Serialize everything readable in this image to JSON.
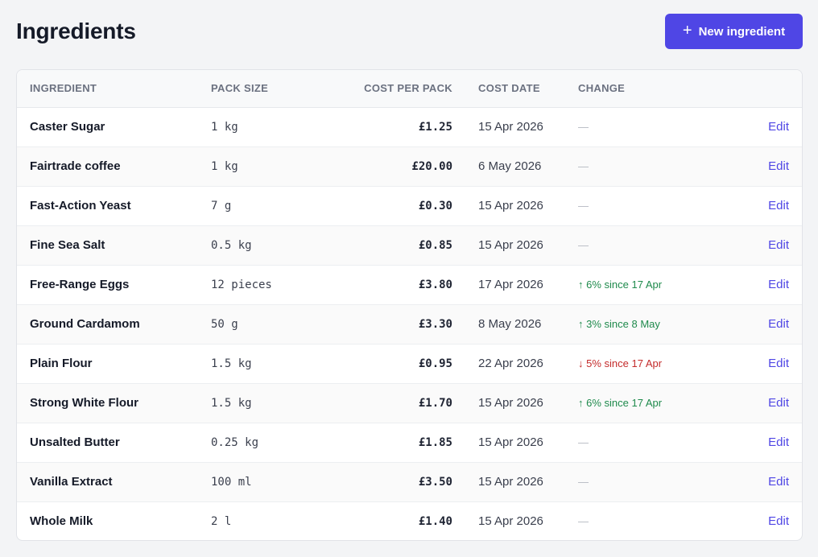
{
  "page": {
    "title": "Ingredients",
    "new_button": {
      "icon": "plus-icon",
      "icon_glyph": "+",
      "label": "New ingredient"
    }
  },
  "colors": {
    "accent": "#4f46e5",
    "increase": "#1f8a4c",
    "decrease": "#c42b2b"
  },
  "table": {
    "columns": [
      "INGREDIENT",
      "PACK SIZE",
      "COST PER PACK",
      "COST DATE",
      "CHANGE",
      ""
    ],
    "edit_label": "Edit",
    "rows": [
      {
        "name": "Caster Sugar",
        "pack": "1 kg",
        "cost": "£1.25",
        "date": "15 Apr 2026",
        "change": "—",
        "dir": "none"
      },
      {
        "name": "Fairtrade coffee",
        "pack": "1 kg",
        "cost": "£20.00",
        "date": "6 May 2026",
        "change": "—",
        "dir": "none"
      },
      {
        "name": "Fast-Action Yeast",
        "pack": "7 g",
        "cost": "£0.30",
        "date": "15 Apr 2026",
        "change": "—",
        "dir": "none"
      },
      {
        "name": "Fine Sea Salt",
        "pack": "0.5 kg",
        "cost": "£0.85",
        "date": "15 Apr 2026",
        "change": "—",
        "dir": "none"
      },
      {
        "name": "Free-Range Eggs",
        "pack": "12 pieces",
        "cost": "£3.80",
        "date": "17 Apr 2026",
        "change": "↑ 6% since 17 Apr",
        "dir": "up"
      },
      {
        "name": "Ground Cardamom",
        "pack": "50 g",
        "cost": "£3.30",
        "date": "8 May 2026",
        "change": "↑ 3% since 8 May",
        "dir": "up"
      },
      {
        "name": "Plain Flour",
        "pack": "1.5 kg",
        "cost": "£0.95",
        "date": "22 Apr 2026",
        "change": "↓ 5% since 17 Apr",
        "dir": "down"
      },
      {
        "name": "Strong White Flour",
        "pack": "1.5 kg",
        "cost": "£1.70",
        "date": "15 Apr 2026",
        "change": "↑ 6% since 17 Apr",
        "dir": "up"
      },
      {
        "name": "Unsalted Butter",
        "pack": "0.25 kg",
        "cost": "£1.85",
        "date": "15 Apr 2026",
        "change": "—",
        "dir": "none"
      },
      {
        "name": "Vanilla Extract",
        "pack": "100 ml",
        "cost": "£3.50",
        "date": "15 Apr 2026",
        "change": "—",
        "dir": "none"
      },
      {
        "name": "Whole Milk",
        "pack": "2 l",
        "cost": "£1.40",
        "date": "15 Apr 2026",
        "change": "—",
        "dir": "none"
      }
    ]
  }
}
